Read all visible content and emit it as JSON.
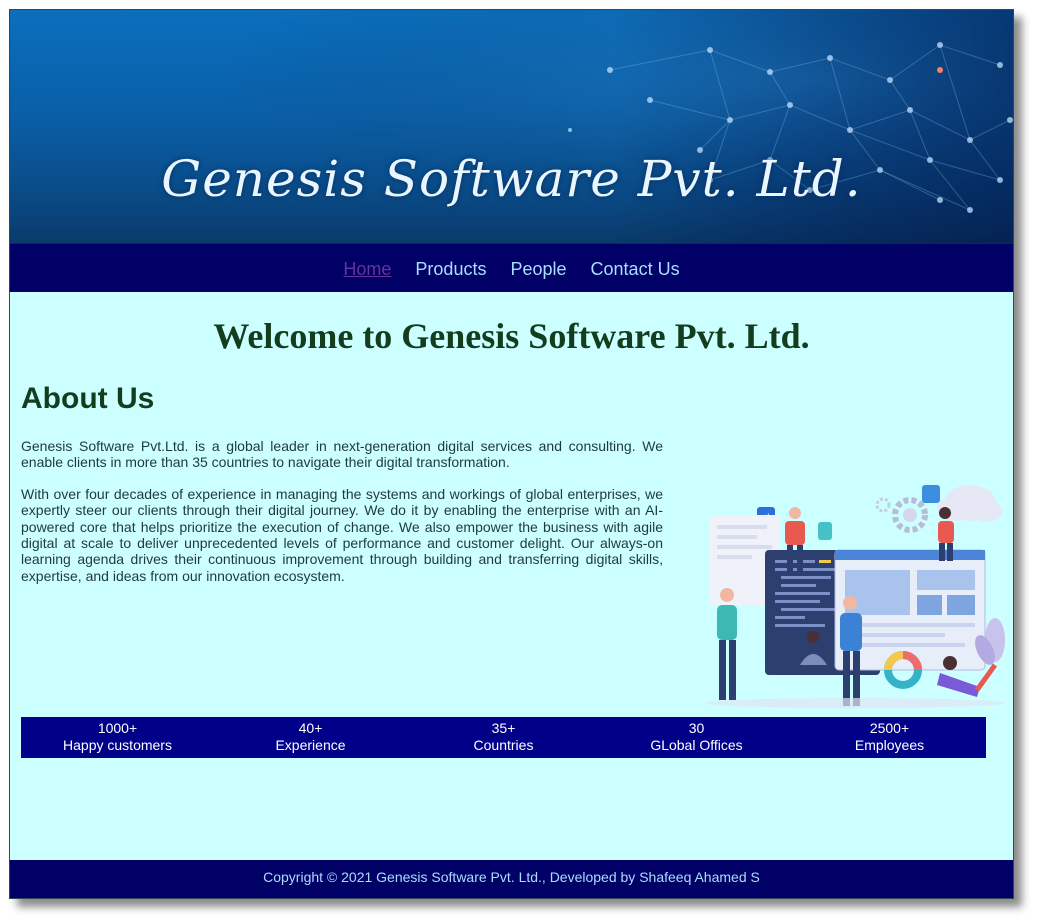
{
  "banner": {
    "title": "Genesis Software Pvt. Ltd."
  },
  "nav": {
    "items": [
      {
        "label": "Home",
        "active": true
      },
      {
        "label": "Products",
        "active": false
      },
      {
        "label": "People",
        "active": false
      },
      {
        "label": "Contact Us",
        "active": false
      }
    ]
  },
  "main": {
    "welcome": "Welcome to Genesis Software Pvt. Ltd.",
    "about_heading": "About Us",
    "paragraphs": [
      "Genesis Software Pvt.Ltd. is a global leader in next-generation digital services and consulting. We enable clients in more than 35 countries to navigate their digital transformation.",
      "With over four decades of experience in managing the systems and workings of global enterprises, we expertly steer our clients through their digital journey. We do it by enabling the enterprise with an AI-powered core that helps prioritize the execution of change. We also empower the business with agile digital at scale to deliver unprecedented levels of performance and customer delight. Our always-on learning agenda drives their continuous improvement through building and transferring digital skills, expertise, and ideas from our innovation ecosystem."
    ]
  },
  "stats": [
    {
      "value": "1000+",
      "label": "Happy customers"
    },
    {
      "value": "40+",
      "label": "Experience"
    },
    {
      "value": "35+",
      "label": "Countries"
    },
    {
      "value": "30",
      "label": "GLobal Offices"
    },
    {
      "value": "2500+",
      "label": "Employees"
    }
  ],
  "footer": {
    "text": "Copyright © 2021 Genesis Software Pvt. Ltd., Developed by Shafeeq Ahamed S"
  },
  "colors": {
    "page_bg": "#ccffff",
    "nav_bg": "#000066",
    "stats_bg": "#000088",
    "heading": "#143d1e",
    "nav_link": "#aaddff",
    "nav_active": "#663399"
  }
}
